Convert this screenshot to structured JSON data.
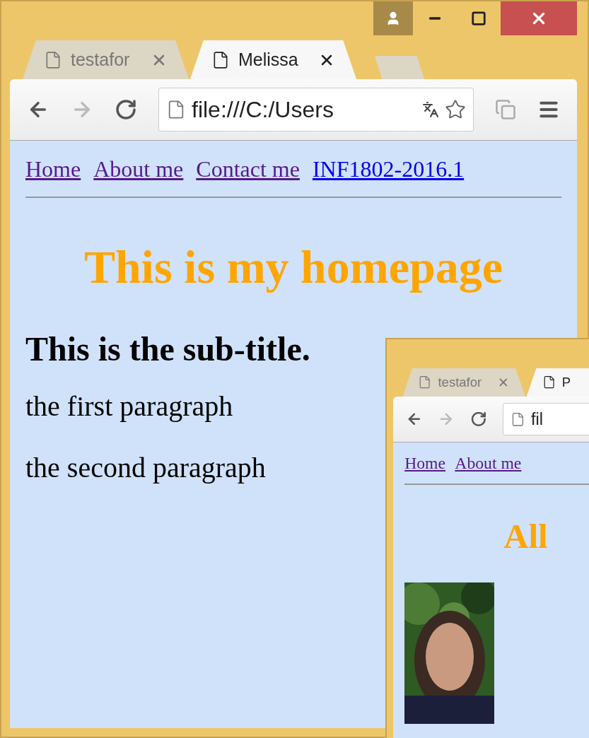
{
  "windows": [
    {
      "tabs": [
        {
          "label": "testafor",
          "selected": false
        },
        {
          "label": "Melissa",
          "selected": true
        }
      ],
      "address": "file:///C:/Users",
      "nav": [
        {
          "label": "Home",
          "visited": true
        },
        {
          "label": "About me",
          "visited": true
        },
        {
          "label": "Contact me",
          "visited": true
        },
        {
          "label": "INF1802-2016.1",
          "visited": false
        }
      ],
      "heading": "This is my homepage",
      "subtitle": "This is the sub-title.",
      "paragraphs": [
        "the first paragraph",
        "the second paragraph"
      ]
    },
    {
      "tabs": [
        {
          "label": "testafor",
          "selected": false
        },
        {
          "label": "P",
          "selected": true
        }
      ],
      "address": "fil",
      "nav": [
        {
          "label": "Home",
          "visited": true
        },
        {
          "label": "About me",
          "visited": true
        }
      ],
      "heading": "All"
    }
  ]
}
